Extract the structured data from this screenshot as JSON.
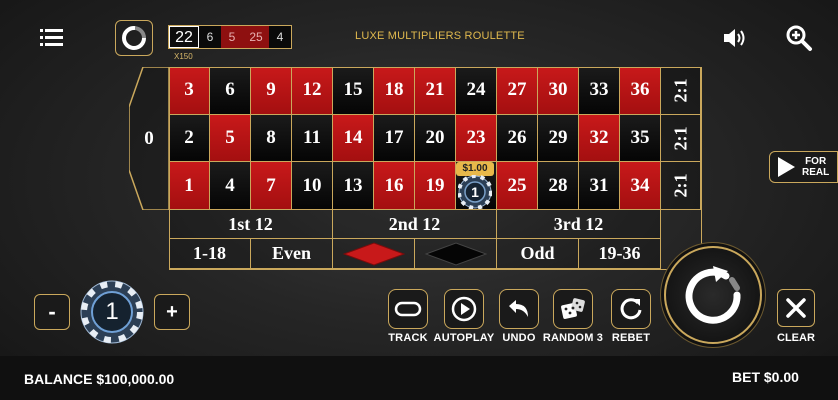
{
  "header": {
    "last_results": [
      {
        "value": "22",
        "color": "black"
      },
      {
        "value": "6",
        "color": "black"
      },
      {
        "value": "5",
        "color": "red"
      },
      {
        "value": "25",
        "color": "red"
      },
      {
        "value": "4",
        "color": "black"
      }
    ],
    "multiplier_label": "X150",
    "title": "LUXE MULTIPLIERS ROULETTE",
    "icons": [
      "menu-icon",
      "history-icon",
      "sound-icon",
      "zoom-icon"
    ]
  },
  "table": {
    "zero": "0",
    "rows": [
      [
        {
          "n": "3",
          "c": "red"
        },
        {
          "n": "6",
          "c": "black"
        },
        {
          "n": "9",
          "c": "red"
        },
        {
          "n": "12",
          "c": "red"
        },
        {
          "n": "15",
          "c": "black"
        },
        {
          "n": "18",
          "c": "red"
        },
        {
          "n": "21",
          "c": "red"
        },
        {
          "n": "24",
          "c": "black"
        },
        {
          "n": "27",
          "c": "red"
        },
        {
          "n": "30",
          "c": "red"
        },
        {
          "n": "33",
          "c": "black"
        },
        {
          "n": "36",
          "c": "red"
        }
      ],
      [
        {
          "n": "2",
          "c": "black"
        },
        {
          "n": "5",
          "c": "red"
        },
        {
          "n": "8",
          "c": "black"
        },
        {
          "n": "11",
          "c": "black"
        },
        {
          "n": "14",
          "c": "red"
        },
        {
          "n": "17",
          "c": "black"
        },
        {
          "n": "20",
          "c": "black"
        },
        {
          "n": "23",
          "c": "red"
        },
        {
          "n": "26",
          "c": "black"
        },
        {
          "n": "29",
          "c": "black"
        },
        {
          "n": "32",
          "c": "red"
        },
        {
          "n": "35",
          "c": "black"
        }
      ],
      [
        {
          "n": "1",
          "c": "red"
        },
        {
          "n": "4",
          "c": "black"
        },
        {
          "n": "7",
          "c": "red"
        },
        {
          "n": "10",
          "c": "black"
        },
        {
          "n": "13",
          "c": "black"
        },
        {
          "n": "16",
          "c": "red"
        },
        {
          "n": "19",
          "c": "red"
        },
        {
          "n": "22",
          "c": "black"
        },
        {
          "n": "25",
          "c": "red"
        },
        {
          "n": "28",
          "c": "black"
        },
        {
          "n": "31",
          "c": "black"
        },
        {
          "n": "34",
          "c": "red"
        }
      ]
    ],
    "column_bets": [
      "2:1",
      "2:1",
      "2:1"
    ],
    "dozens": [
      "1st 12",
      "2nd 12",
      "3rd 12"
    ],
    "outside": {
      "low": "1-18",
      "even": "Even",
      "odd": "Odd",
      "high": "19-36"
    },
    "placed_bet": {
      "number": "22",
      "amount": "$1.00",
      "chip": "1"
    },
    "colors": {
      "red": "#b31415",
      "black": "#0a0a0a",
      "gold": "#caa85c"
    }
  },
  "for_real": {
    "label_line1": "FOR",
    "label_line2": "REAL"
  },
  "chip_selector": {
    "minus": "-",
    "plus": "+",
    "value": "1"
  },
  "actions": [
    {
      "label": "TRACK",
      "icon": "track-icon"
    },
    {
      "label": "AUTOPLAY",
      "icon": "play-icon"
    },
    {
      "label": "UNDO",
      "icon": "undo-icon"
    },
    {
      "label": "RANDOM 3",
      "icon": "dice-icon"
    },
    {
      "label": "REBET",
      "icon": "rebet-icon"
    }
  ],
  "spin": {
    "icon": "spin-icon"
  },
  "clear": {
    "label": "CLEAR",
    "icon": "close-icon"
  },
  "status": {
    "balance": "BALANCE $100,000.00",
    "bet": "BET $0.00"
  }
}
